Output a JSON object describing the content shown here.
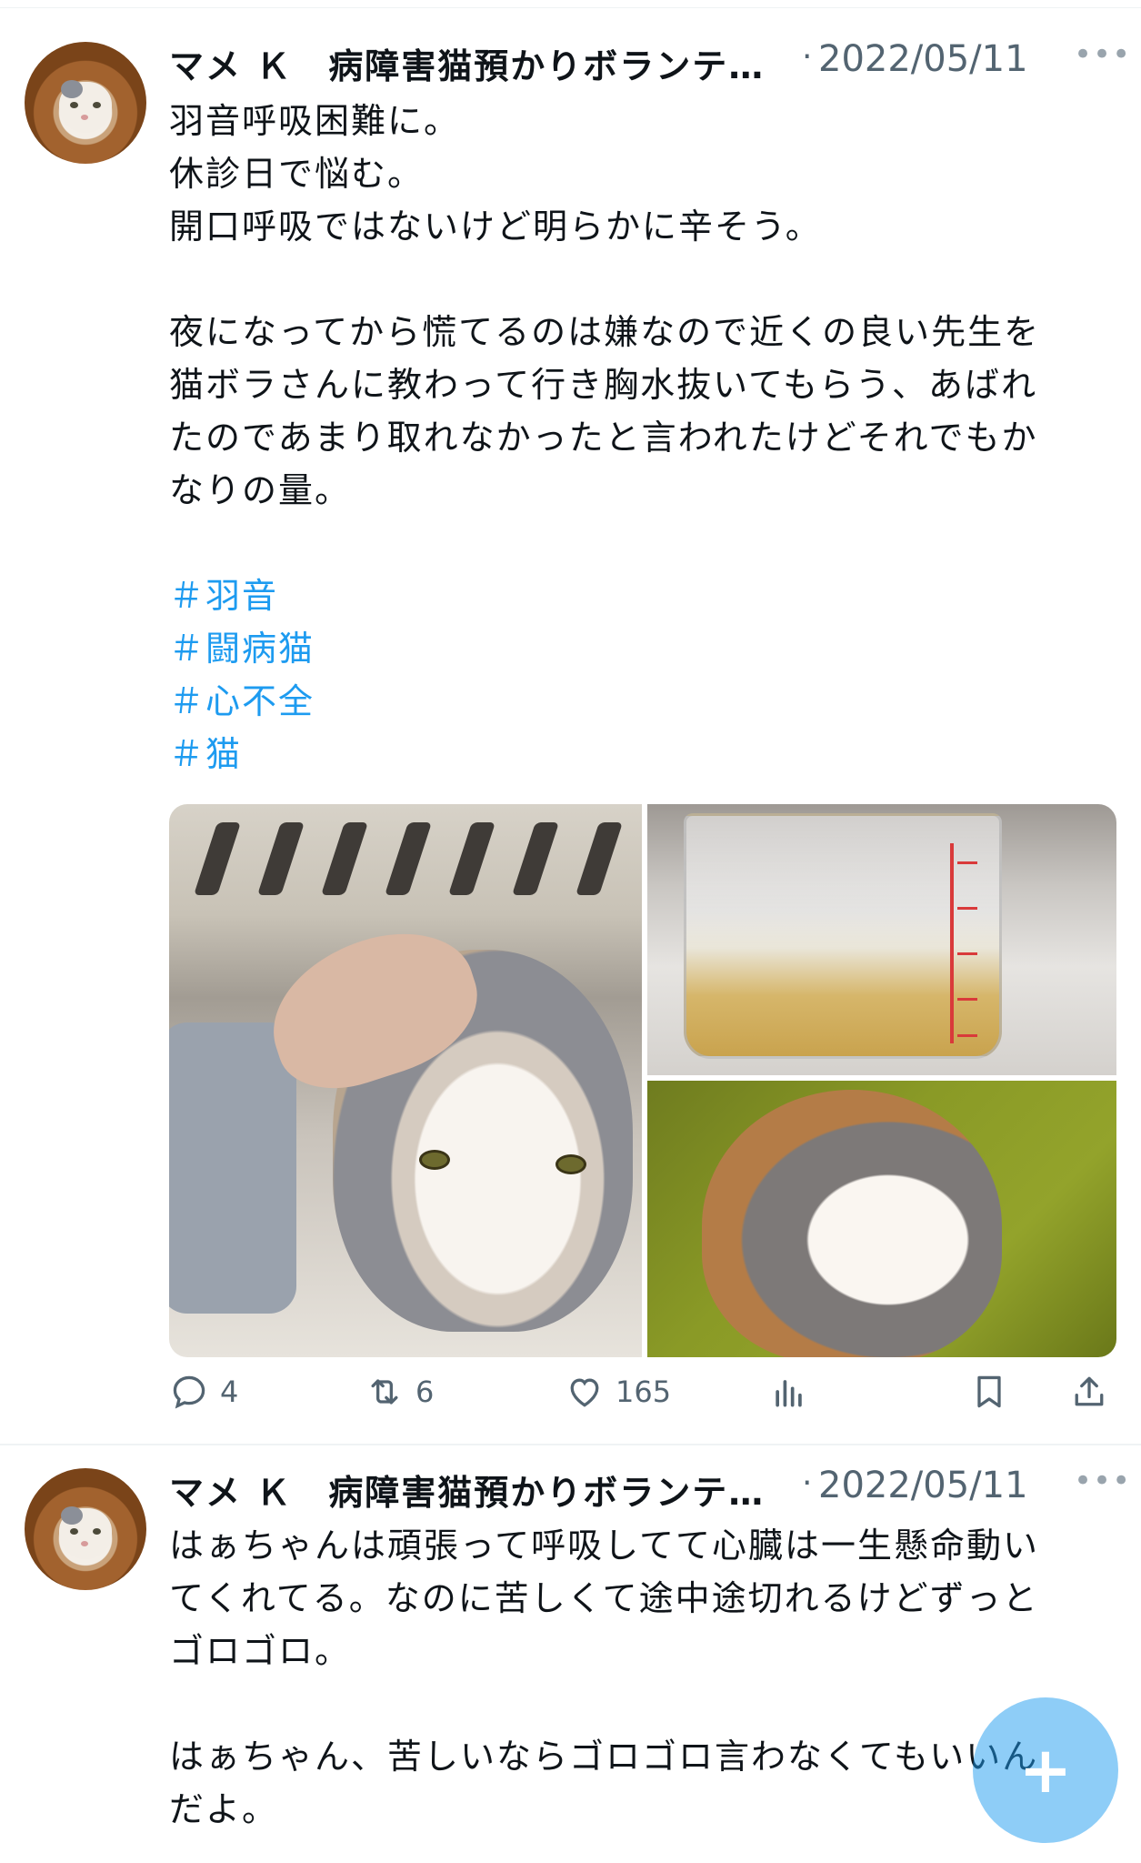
{
  "tweets": [
    {
      "author_name": "マメ Ｋ　病障害猫預かりボランテ…",
      "separator": "·",
      "date": "2022/05/11",
      "more_label": "•••",
      "text_lines": [
        "羽音呼吸困難に。",
        "休診日で悩む。",
        "開口呼吸ではないけど明らかに辛そう。",
        "",
        "夜になってから慌てるのは嫌なので近くの良い先生を",
        "猫ボラさんに教わって行き胸水抜いてもらう、あばれ",
        "たのであまり取れなかったと言われたけどそれでもか",
        "なりの量。",
        ""
      ],
      "hashtags": [
        "＃羽音",
        "＃闘病猫",
        "＃心不全",
        "＃猫"
      ],
      "media": [
        "cat-in-carrier-photo",
        "measuring-cup-photo",
        "cat-on-blanket-photo"
      ],
      "actions": {
        "reply_count": "4",
        "retweet_count": "6",
        "like_count": "165"
      }
    },
    {
      "author_name": "マメ Ｋ　病障害猫預かりボランテ…",
      "separator": "·",
      "date": "2022/05/11",
      "more_label": "•••",
      "text_lines": [
        "はぁちゃんは頑張って呼吸してて心臓は一生懸命動い",
        "てくれてる。なのに苦しくて途中途切れるけどずっと",
        "ゴロゴロ。",
        "",
        "はぁちゃん、苦しいならゴロゴロ言わなくてもいいん",
        "だよ。"
      ]
    }
  ],
  "fab_label": "+",
  "colors": {
    "accent": "#1d9bf0",
    "text": "#0f1419",
    "secondary": "#536471"
  },
  "icons": [
    "reply-icon",
    "retweet-icon",
    "like-icon",
    "views-icon",
    "bookmark-icon",
    "share-icon",
    "more-icon",
    "compose-icon"
  ]
}
